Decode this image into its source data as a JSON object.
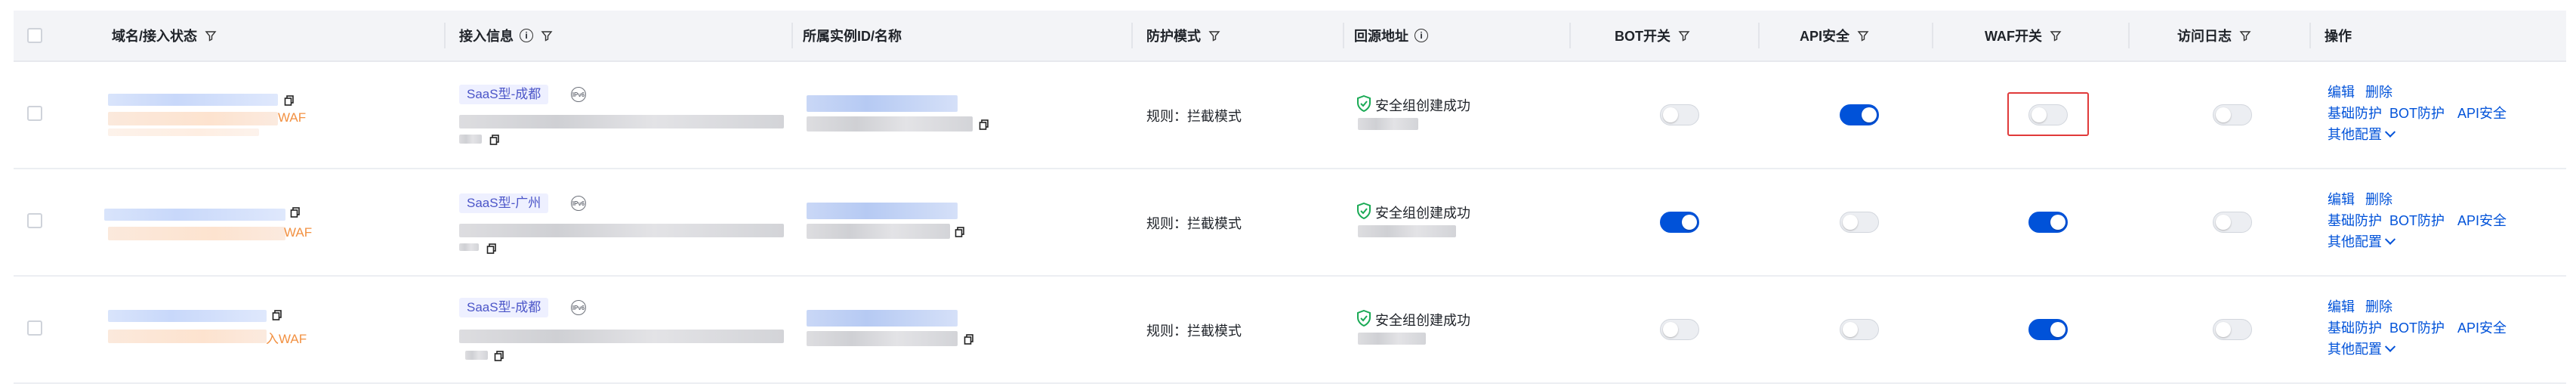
{
  "columns": {
    "domain": "域名/接入状态",
    "access": "接入信息",
    "instance": "所属实例ID/名称",
    "mode": "防护模式",
    "origin": "回源地址",
    "bot": "BOT开关",
    "api": "API安全",
    "waf": "WAF开关",
    "log": "访问日志",
    "action": "操作"
  },
  "rows": [
    {
      "waf_suffix": "WAF",
      "tag": "SaaS型-成都",
      "ipv6_label": "IPv6",
      "mode": "规则：拦截模式",
      "origin_status": "安全组创建成功",
      "bot_on": false,
      "api_on": true,
      "waf_on": false,
      "log_on": false,
      "waf_highlighted": true,
      "action_edit": "编辑",
      "action_delete": "删除",
      "action_basic": "基础防护",
      "action_bot": "BOT防护",
      "action_api": "API安全",
      "action_more": "其他配置"
    },
    {
      "waf_suffix": "WAF",
      "tag": "SaaS型-广州",
      "ipv6_label": "IPv6",
      "mode": "规则：拦截模式",
      "origin_status": "安全组创建成功",
      "bot_on": true,
      "api_on": false,
      "waf_on": true,
      "log_on": false,
      "waf_highlighted": false,
      "action_edit": "编辑",
      "action_delete": "删除",
      "action_basic": "基础防护",
      "action_bot": "BOT防护",
      "action_api": "API安全",
      "action_more": "其他配置"
    },
    {
      "waf_suffix": "入WAF",
      "tag": "SaaS型-成都",
      "ipv6_label": "IPv6",
      "mode": "规则：拦截模式",
      "origin_status": "安全组创建成功",
      "bot_on": false,
      "api_on": false,
      "waf_on": true,
      "log_on": false,
      "waf_highlighted": false,
      "action_edit": "编辑",
      "action_delete": "删除",
      "action_basic": "基础防护",
      "action_bot": "BOT防护",
      "action_api": "API安全",
      "action_more": "其他配置"
    }
  ],
  "colors": {
    "toggle_on": "#0052d9",
    "link": "#0052d9",
    "waf_text": "#f29142",
    "success": "#1aaa55",
    "highlight": "#e03a3a"
  }
}
